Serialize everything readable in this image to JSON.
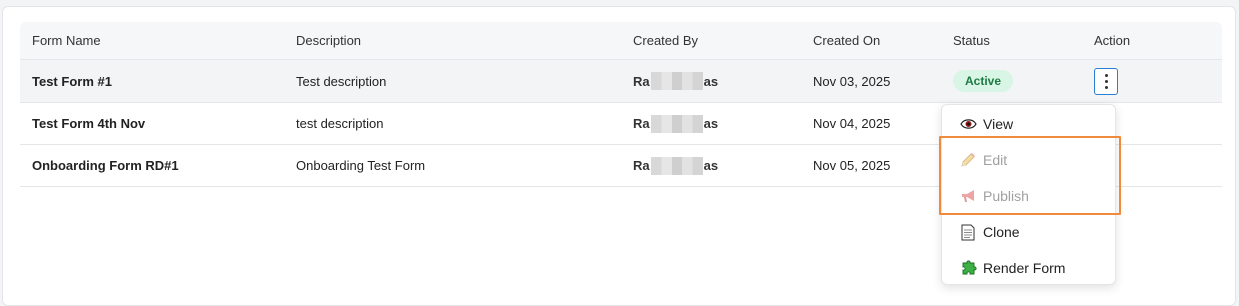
{
  "table": {
    "headers": {
      "form_name": "Form Name",
      "description": "Description",
      "created_by": "Created By",
      "created_on": "Created On",
      "status": "Status",
      "action": "Action"
    },
    "rows": [
      {
        "form_name": "Test Form #1",
        "description": "Test description",
        "created_by_start": "Ra",
        "created_by_end": "as",
        "created_on": "Nov 03, 2025",
        "status": "Active"
      },
      {
        "form_name": "Test Form 4th Nov",
        "description": "test description",
        "created_by_start": "Ra",
        "created_by_end": "as",
        "created_on": "Nov 04, 2025",
        "status": ""
      },
      {
        "form_name": "Onboarding Form RD#1",
        "description": "Onboarding Test Form",
        "created_by_start": "Ra",
        "created_by_end": "as",
        "created_on": "Nov 05, 2025",
        "status": ""
      }
    ]
  },
  "action_menu": {
    "items": [
      {
        "label": "View",
        "icon": "eye-icon",
        "disabled": false
      },
      {
        "label": "Edit",
        "icon": "pencil-icon",
        "disabled": true
      },
      {
        "label": "Publish",
        "icon": "megaphone-icon",
        "disabled": true
      },
      {
        "label": "Clone",
        "icon": "document-icon",
        "disabled": false
      },
      {
        "label": "Render Form",
        "icon": "puzzle-icon",
        "disabled": false
      }
    ]
  },
  "colors": {
    "active_badge_bg": "#d8f5e5",
    "active_badge_text": "#1d7a45",
    "kebab_border": "#2a7fd4",
    "highlight_border": "#f08a3c",
    "disabled_text": "#a0a0a0"
  }
}
